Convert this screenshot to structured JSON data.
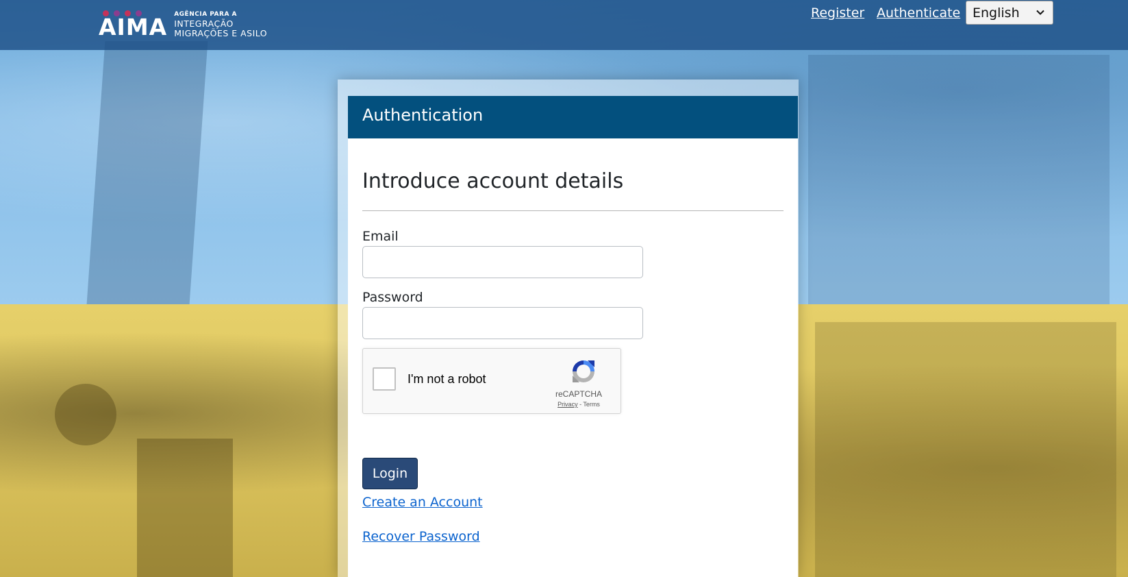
{
  "header": {
    "logo": {
      "word": "AIMA",
      "line1": "AGÊNCIA PARA A",
      "line2": "INTEGRAÇÃO",
      "line3": "MIGRAÇÕES E ASILO",
      "dot_colors": [
        "#c4325a",
        "#8a3d8f",
        "#c4325a",
        "#8a3d8f"
      ]
    },
    "nav": {
      "register": "Register",
      "authenticate": "Authenticate"
    },
    "language": {
      "selected": "English",
      "icon": "chevron-down-icon"
    }
  },
  "card": {
    "header_title": "Authentication",
    "section_title": "Introduce account details",
    "email_label": "Email",
    "email_value": "",
    "password_label": "Password",
    "password_value": "",
    "recaptcha": {
      "label": "I'm not a robot",
      "brand": "reCAPTCHA",
      "privacy": "Privacy",
      "separator": " - ",
      "terms": "Terms",
      "icon": "recaptcha-logo-icon"
    },
    "login_label": "Login",
    "create_account_label": "Create an Account",
    "recover_password_label": "Recover Password"
  },
  "colors": {
    "header_bg": "#1e5087",
    "card_header_bg": "#03507e",
    "login_bg": "#2a4a78",
    "link": "#0b63ce",
    "flag_blue": "#86bde8",
    "flag_yellow": "#dcc45e"
  }
}
